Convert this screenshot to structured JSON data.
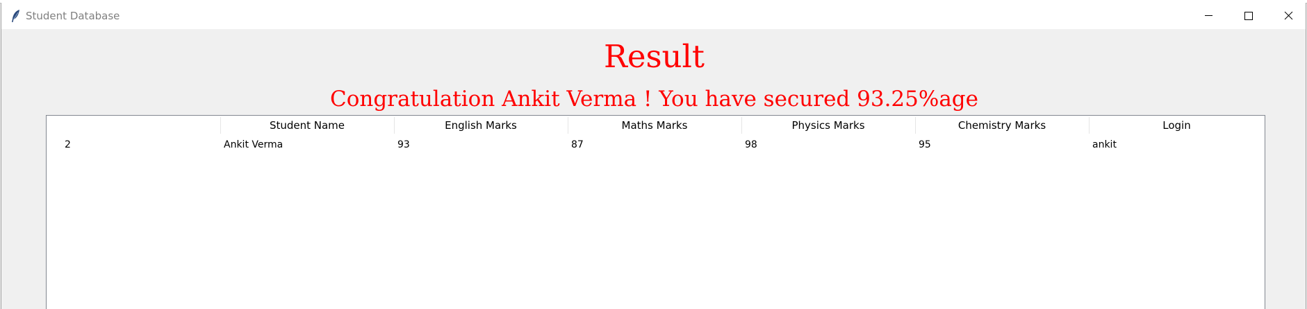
{
  "window": {
    "title": "Student Database"
  },
  "result": {
    "heading": "Result",
    "message": "Congratulation Ankit Verma ! You have secured 93.25%age"
  },
  "table": {
    "columns": [
      "",
      "Student Name",
      "English Marks",
      "Maths Marks",
      "Physics Marks",
      "Chemistry Marks",
      "Login"
    ],
    "rows": [
      [
        "2",
        "Ankit Verma",
        "93",
        "87",
        "98",
        "95",
        "ankit"
      ]
    ]
  },
  "colors": {
    "accent_text": "#ff0000",
    "window_bg": "#f0f0f0",
    "table_bg": "#ffffff"
  },
  "icons": {
    "app": "feather-icon",
    "minimize": "minimize-icon",
    "maximize": "maximize-icon",
    "close": "close-icon"
  }
}
